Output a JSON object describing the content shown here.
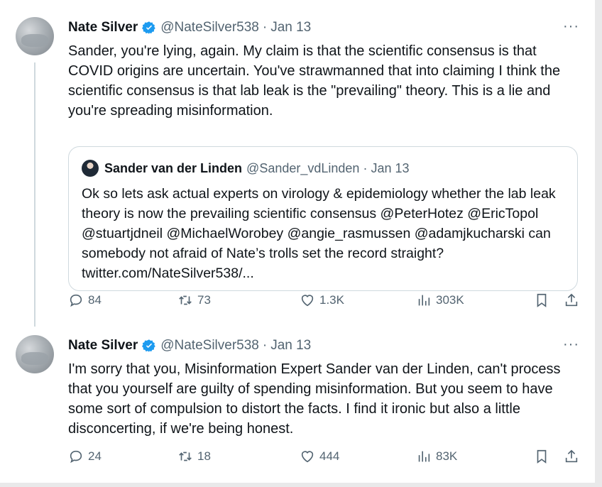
{
  "tweets": [
    {
      "author": "Nate Silver",
      "handle": "@NateSilver538",
      "separator": "·",
      "date": "Jan 13",
      "more": "···",
      "text": "Sander, you're lying, again. My claim is that the scientific consensus is that COVID origins are uncertain. You've strawmanned that into claiming I think the scientific consensus is that lab leak is the \"prevailing\" theory. This is a lie and you're spreading misinformation.",
      "quote": {
        "author": "Sander van der Linden",
        "handle": "@Sander_vdLinden",
        "separator": "·",
        "date": "Jan 13",
        "text": "Ok so lets ask actual experts on virology & epidemiology whether the lab leak theory is now the prevailing scientific consensus @PeterHotez @EricTopol @stuartjdneil @MichaelWorobey @angie_rasmussen @adamjkucharski can somebody not afraid of Nate’s trolls set the record straight? twitter.com/NateSilver538/..."
      },
      "stats": {
        "replies": "84",
        "retweets": "73",
        "likes": "1.3K",
        "views": "303K"
      }
    },
    {
      "author": "Nate Silver",
      "handle": "@NateSilver538",
      "separator": "·",
      "date": "Jan 13",
      "more": "···",
      "text": "I'm sorry that you, Misinformation Expert Sander van der Linden, can't process that you yourself are guilty of spending misinformation. But you seem to have some sort of compulsion to distort the facts. I find it ironic but also a little disconcerting, if we're being honest.",
      "stats": {
        "replies": "24",
        "retweets": "18",
        "likes": "444",
        "views": "83K"
      }
    }
  ],
  "colors": {
    "verified": "#1d9bf0",
    "text": "#0f1419",
    "muted": "#536471",
    "border": "#cfd9de"
  },
  "icons": [
    "verified-badge-icon",
    "reply-icon",
    "retweet-icon",
    "like-icon",
    "views-icon",
    "bookmark-icon",
    "share-icon",
    "more-icon"
  ]
}
